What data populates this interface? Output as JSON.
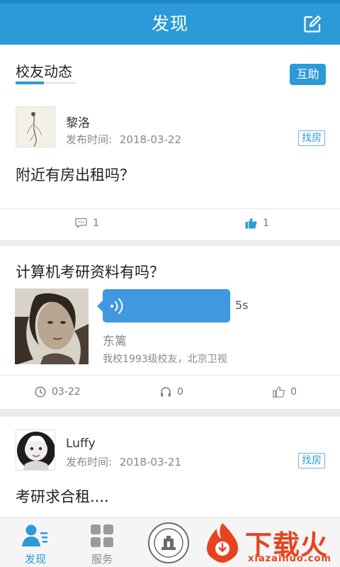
{
  "header": {
    "title": "发现"
  },
  "section": {
    "tab_label": "校友动态",
    "action_label": "互助"
  },
  "posts": [
    {
      "author": "黎洛",
      "time_label": "发布时间:",
      "date": "2018-03-22",
      "tag": "找房",
      "text": "附近有房出租吗？",
      "comments": "1",
      "likes": "1"
    },
    {
      "text": "计算机考研资料有吗？",
      "voice_duration": "5s",
      "author": "东篱",
      "desc": "我校1993级校友，北京卫视",
      "date": "03-22",
      "listens": "0",
      "likes": "0"
    },
    {
      "author": "Luffy",
      "time_label": "发布时间:",
      "date": "2018-03-21",
      "tag": "找房",
      "text": "考研求合租...."
    }
  ],
  "tabbar": {
    "discover": "发现",
    "service": "服务"
  },
  "watermark": {
    "brand": "下载火",
    "url": "xiazaihuo.com"
  },
  "colors": {
    "primary": "#2d9ad8",
    "bubble": "#3f98e0",
    "watermark": "#e8431e"
  }
}
